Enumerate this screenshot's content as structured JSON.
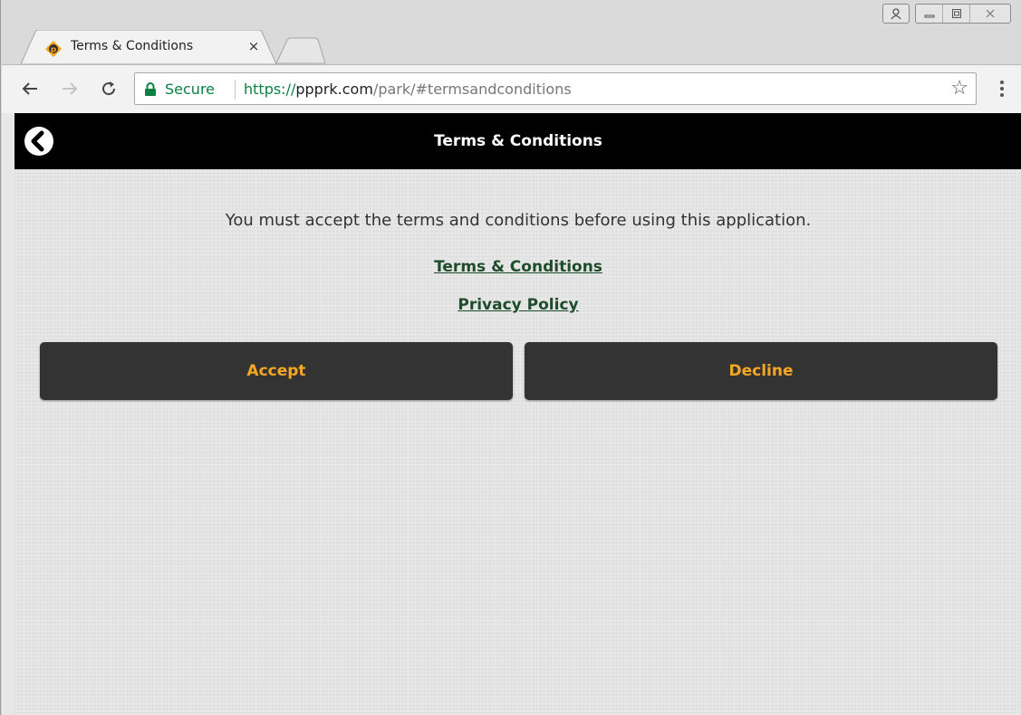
{
  "browser": {
    "tab": {
      "title": "Terms & Conditions",
      "close_label": "×"
    },
    "omnibox": {
      "secure_label": "Secure",
      "url_scheme": "https://",
      "url_host": "ppprk.com",
      "url_path": "/park/#termsandconditions"
    },
    "star_glyph": "☆"
  },
  "app": {
    "header_title": "Terms & Conditions",
    "notice": "You must accept the terms and conditions before using this application.",
    "links": {
      "terms": "Terms & Conditions",
      "privacy": "Privacy Policy"
    },
    "buttons": {
      "accept": "Accept",
      "decline": "Decline"
    }
  },
  "colors": {
    "header_bg": "#000000",
    "button_bg": "#333333",
    "button_text": "#f5a623",
    "link": "#1d4d2b",
    "secure_green": "#0b8043"
  },
  "icons": {
    "favicon": "ppprk-favicon-icon",
    "back": "back-chevron-icon",
    "lock": "lock-icon",
    "star": "bookmark-star-icon",
    "menu": "kebab-menu-icon"
  }
}
